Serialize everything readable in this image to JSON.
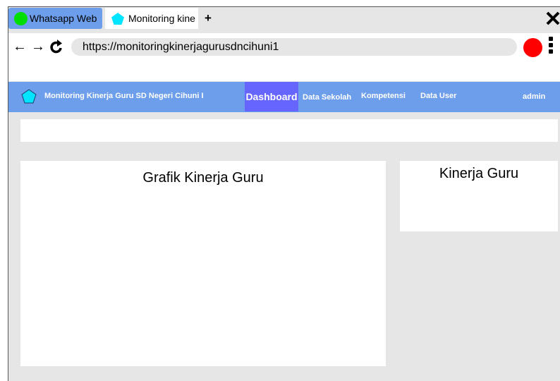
{
  "browser": {
    "tabs": [
      {
        "label": "Whatsapp Web",
        "icon": "green-circle-icon",
        "color": "#00dd00"
      },
      {
        "label": "Monitoring kine",
        "icon": "pentagon-icon",
        "color": "#00e5ff"
      }
    ],
    "new_tab_label": "+",
    "url": "https://monitoringkinerjagurusdncihuni1"
  },
  "app": {
    "title": "Monitoring Kinerja Guru SD Negeri Cihuni I",
    "nav": [
      {
        "label": "Dashboard",
        "active": true
      },
      {
        "label": "Data Sekolah"
      },
      {
        "label": "Kompetensi"
      },
      {
        "label": "Data User"
      }
    ],
    "user": "admin",
    "colors": {
      "nav_bg": "#6d9eeb",
      "nav_active": "#6666ff",
      "page_bg": "#e6e6e6"
    }
  },
  "cards": {
    "main_title": "Grafik Kinerja Guru",
    "side_title": "Kinerja Guru"
  }
}
